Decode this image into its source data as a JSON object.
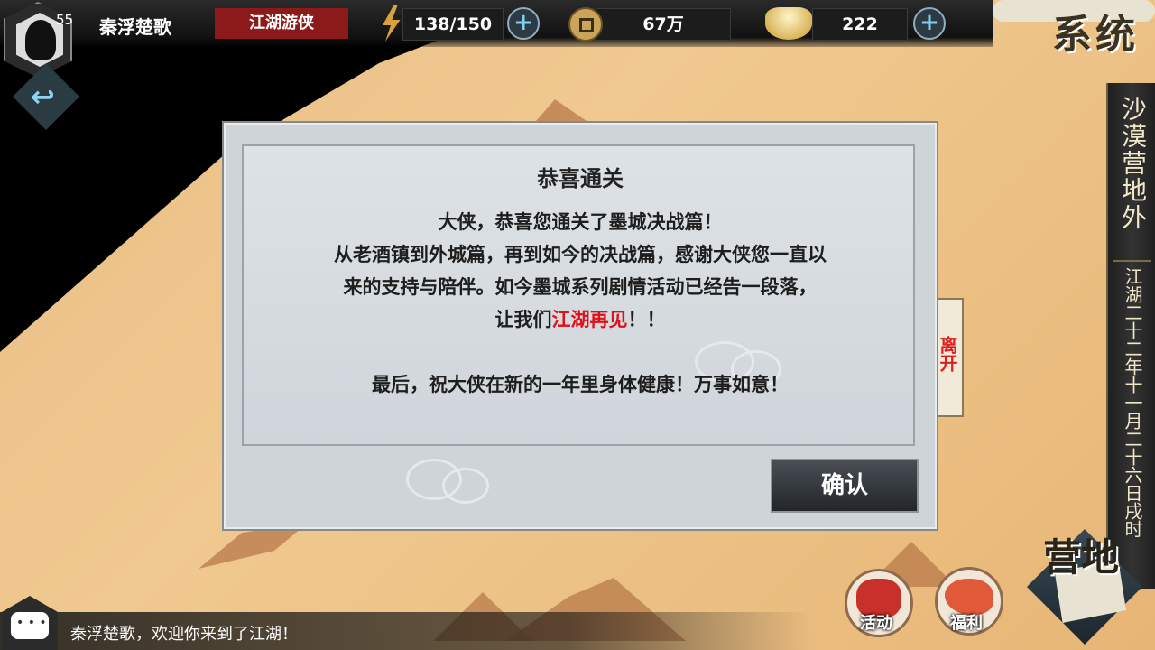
{
  "colors": {
    "accent_red": "#e0101a",
    "badge_red": "#8c1a1a",
    "plus_cyan": "#7fd0f0"
  },
  "player": {
    "level": "55",
    "name": "秦浮楚歌",
    "title": "江湖游侠"
  },
  "resources": {
    "stamina": "138/150",
    "coins": "67万",
    "ingots": "222"
  },
  "icons": {
    "avatar": "avatar-portrait",
    "back": "back-arrow-icon",
    "stamina": "lightning-icon",
    "coins": "coin-icon",
    "ingots": "gold-ingot-icon",
    "plus": "plus-icon",
    "chat": "chat-bubble-icon"
  },
  "system": {
    "label": "系统"
  },
  "location": {
    "name": "沙漠营地外",
    "date": "江湖二十二年十一月二十六日戌时"
  },
  "leave": {
    "label": "离开"
  },
  "dialog": {
    "title": "恭喜通关",
    "line1": "大侠，恭喜您通关了墨城决战篇！",
    "line2": "从老酒镇到外城篇，再到如今的决战篇，感谢大侠您一直以",
    "line3": "来的支持与陪伴。如今墨城系列剧情活动已经告一段落，",
    "line4_prefix": "让我们",
    "line4_highlight": "江湖再见",
    "line4_suffix": "！！",
    "line5": "最后，祝大侠在新的一年里身体健康！万事如意！",
    "confirm": "确认"
  },
  "chat": {
    "message": "秦浮楚歌，欢迎你来到了江湖！"
  },
  "buttons": {
    "activity": "活动",
    "benefits": "福利",
    "camp": "营地"
  }
}
